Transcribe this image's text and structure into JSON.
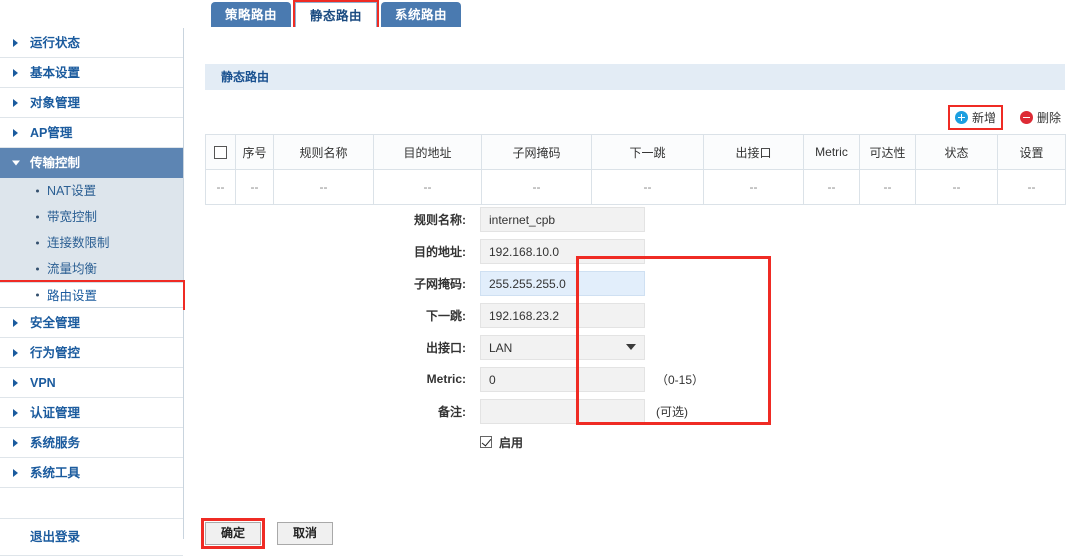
{
  "tabs": [
    {
      "label": "策略路由",
      "active": false,
      "highlighted": false
    },
    {
      "label": "静态路由",
      "active": true,
      "highlighted": true
    },
    {
      "label": "系统路由",
      "active": false,
      "highlighted": false
    }
  ],
  "sidebar": {
    "items": [
      {
        "label": "运行状态"
      },
      {
        "label": "基本设置"
      },
      {
        "label": "对象管理"
      },
      {
        "label": "AP管理"
      },
      {
        "label": "传输控制"
      },
      {
        "label": "安全管理"
      },
      {
        "label": "行为管控"
      },
      {
        "label": "VPN"
      },
      {
        "label": "认证管理"
      },
      {
        "label": "系统服务"
      },
      {
        "label": "系统工具"
      }
    ],
    "subitems": [
      {
        "label": "NAT设置"
      },
      {
        "label": "带宽控制"
      },
      {
        "label": "连接数限制"
      },
      {
        "label": "流量均衡"
      },
      {
        "label": "路由设置"
      }
    ],
    "logout": "退出登录"
  },
  "panel": {
    "title": "静态路由"
  },
  "toolbar": {
    "add_label": "新增",
    "delete_label": "删除",
    "add_icon": "plus-circle-icon",
    "delete_icon": "minus-circle-icon"
  },
  "table": {
    "headers": [
      "",
      "序号",
      "规则名称",
      "目的地址",
      "子网掩码",
      "下一跳",
      "出接口",
      "Metric",
      "可达性",
      "状态",
      "设置"
    ],
    "rows": [
      [
        "--",
        "--",
        "--",
        "--",
        "--",
        "--",
        "--",
        "--",
        "--",
        "--",
        "--"
      ]
    ]
  },
  "form": {
    "fields": [
      {
        "label": "规则名称:",
        "value": "internet_cpb",
        "hint": ""
      },
      {
        "label": "目的地址:",
        "value": "192.168.10.0",
        "hint": ""
      },
      {
        "label": "子网掩码:",
        "value": "255.255.255.0",
        "hint": ""
      },
      {
        "label": "下一跳:",
        "value": "192.168.23.2",
        "hint": ""
      },
      {
        "label": "出接口:",
        "value": "LAN",
        "hint": ""
      },
      {
        "label": "Metric:",
        "value": "0",
        "hint": "（0-15）"
      },
      {
        "label": "备注:",
        "value": "",
        "hint": "(可选)"
      }
    ],
    "enable_label": "启用",
    "ok_label": "确定",
    "cancel_label": "取消"
  },
  "colors": {
    "tab_blue": "#4a7ab0",
    "nav_active": "#5d85b3",
    "nav_link": "#1b5b9e",
    "highlight_red": "#ef2b24",
    "field_focus": "#e2eefb",
    "panel_header": "#e3ecf5"
  }
}
